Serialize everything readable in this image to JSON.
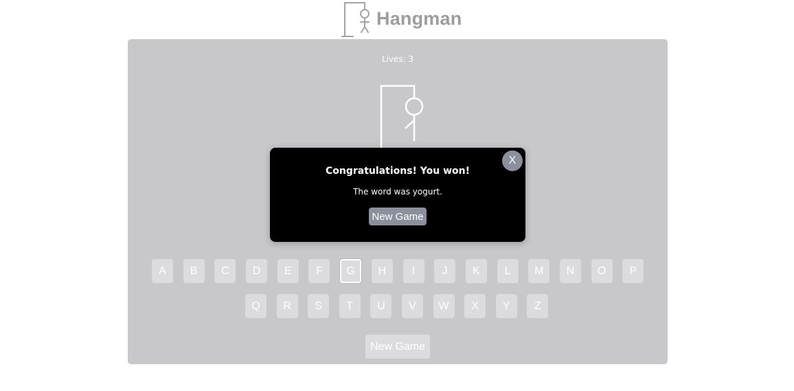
{
  "header": {
    "title": "Hangman",
    "logo_icon": "hangman-logo-icon"
  },
  "board": {
    "lives": "Lives: 3",
    "keyboard": {
      "row1": [
        "A",
        "B",
        "C",
        "D",
        "E",
        "F",
        "G",
        "H",
        "I",
        "J",
        "K",
        "L",
        "M",
        "N",
        "O",
        "P"
      ],
      "row2": [
        "Q",
        "R",
        "S",
        "T",
        "U",
        "V",
        "W",
        "X",
        "Y",
        "Z"
      ]
    },
    "guessed_letters": [
      "G"
    ],
    "new_game_label": "New Game"
  },
  "modal": {
    "title": "Congratulations! You won!",
    "message": "The word was yogurt.",
    "new_game_label": "New Game",
    "close_label": "X"
  },
  "colors": {
    "overlay_board": "#c8c8ca",
    "key_bg": "#dcdcde",
    "modal_bg": "#000000",
    "modal_button": "#8c8f9c"
  }
}
